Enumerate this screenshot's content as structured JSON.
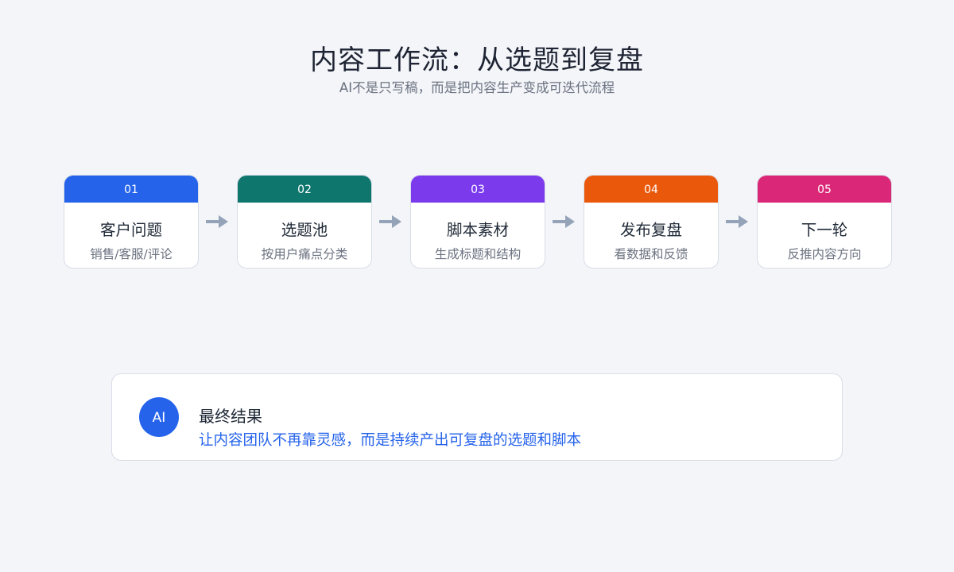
{
  "header": {
    "title": "内容工作流：从选题到复盘",
    "subtitle": "AI不是只写稿，而是把内容生产变成可迭代流程"
  },
  "steps": [
    {
      "num": "01",
      "title": "客户问题",
      "desc": "销售/客服/评论",
      "color": "#2563eb"
    },
    {
      "num": "02",
      "title": "选题池",
      "desc": "按用户痛点分类",
      "color": "#0f766e"
    },
    {
      "num": "03",
      "title": "脚本素材",
      "desc": "生成标题和结构",
      "color": "#7c3aed"
    },
    {
      "num": "04",
      "title": "发布复盘",
      "desc": "看数据和反馈",
      "color": "#ea580c"
    },
    {
      "num": "05",
      "title": "下一轮",
      "desc": "反推内容方向",
      "color": "#db2777"
    }
  ],
  "arrow_color": "#94a3b8",
  "result": {
    "badge": "AI",
    "title": "最终结果",
    "desc": "让内容团队不再靠灵感，而是持续产出可复盘的选题和脚本",
    "accent": "#2563eb"
  }
}
